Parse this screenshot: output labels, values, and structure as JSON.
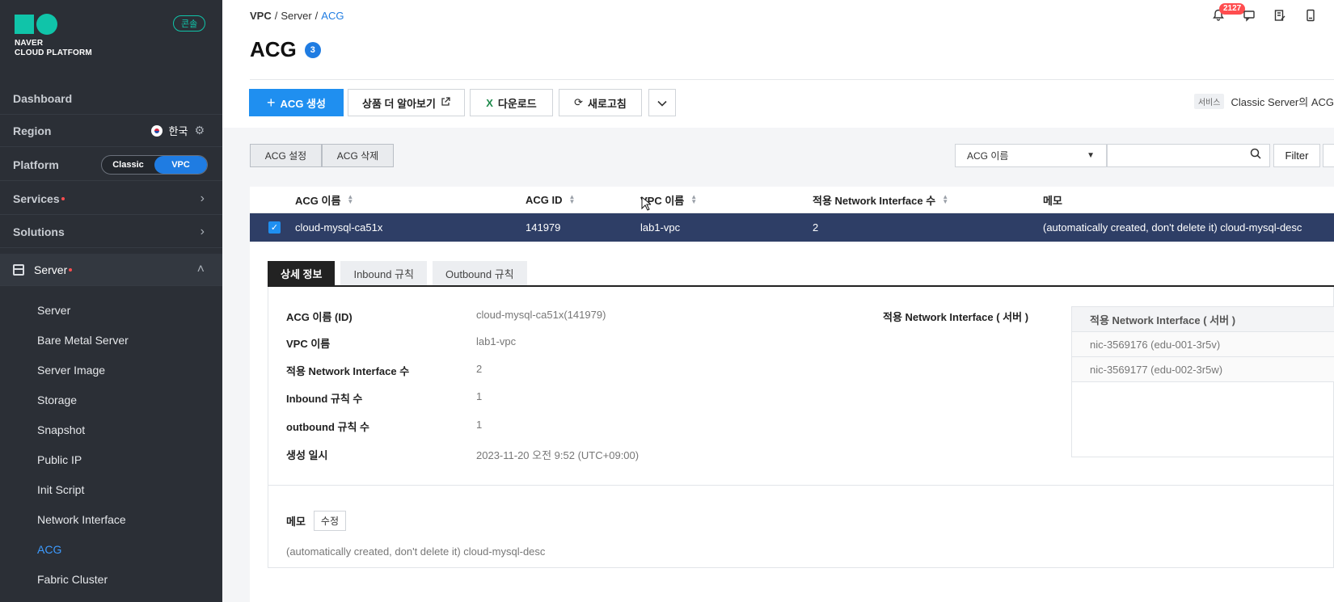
{
  "brand": {
    "line1": "NAVER",
    "line2": "CLOUD PLATFORM",
    "console_badge": "콘솔"
  },
  "sidebar": {
    "dashboard": "Dashboard",
    "region_label": "Region",
    "region_value": "한국",
    "platform_label": "Platform",
    "platform_options": [
      "Classic",
      "VPC"
    ],
    "platform_selected": "VPC",
    "services": "Services",
    "solutions": "Solutions",
    "server_group": "Server",
    "sub_items": [
      "Server",
      "Bare Metal Server",
      "Server Image",
      "Storage",
      "Snapshot",
      "Public IP",
      "Init Script",
      "Network Interface",
      "ACG",
      "Fabric Cluster"
    ],
    "active_item": "ACG"
  },
  "breadcrumb": [
    "VPC",
    "Server",
    "ACG"
  ],
  "page": {
    "title": "ACG",
    "count": "3"
  },
  "header": {
    "notification_count": "2127"
  },
  "toolbar": {
    "create": "ACG 생성",
    "learn_more": "상품 더 알아보기",
    "download": "다운로드",
    "refresh": "새로고침",
    "service_tag": "서비스",
    "service_note": "Classic Server의 ACG"
  },
  "actions": {
    "settings": "ACG 설정",
    "delete": "ACG 삭제"
  },
  "search": {
    "field": "ACG 이름",
    "filter": "Filter"
  },
  "table": {
    "columns": [
      "ACG 이름",
      "ACG ID",
      "VPC 이름",
      "적용 Network Interface 수",
      "메모"
    ],
    "rows": [
      {
        "name": "cloud-mysql-ca51x",
        "id": "141979",
        "vpc": "lab1-vpc",
        "ni_count": "2",
        "memo": "(automatically created, don't delete it) cloud-mysql-desc"
      }
    ]
  },
  "detail": {
    "tabs": [
      "상세 정보",
      "Inbound 규칙",
      "Outbound 규칙"
    ],
    "active_tab": "상세 정보",
    "fields": [
      {
        "label": "ACG 이름 (ID)",
        "value": "cloud-mysql-ca51x(141979)"
      },
      {
        "label": "VPC 이름",
        "value": "lab1-vpc"
      },
      {
        "label": "적용 Network Interface 수",
        "value": "2"
      },
      {
        "label": "Inbound 규칙 수",
        "value": "1"
      },
      {
        "label": "outbound 규칙 수",
        "value": "1"
      },
      {
        "label": "생성 일시",
        "value": "2023-11-20 오전 9:52 (UTC+09:00)"
      }
    ],
    "ni_label": "적용 Network Interface ( 서버 )",
    "ni_header": "적용 Network Interface ( 서버 )",
    "ni_rows": [
      "nic-3569176 (edu-001-3r5v)",
      "nic-3569177 (edu-002-3r5w)"
    ],
    "memo_label": "메모",
    "memo_edit": "수정",
    "memo_value": "(automatically created, don't delete it) cloud-mysql-desc"
  }
}
